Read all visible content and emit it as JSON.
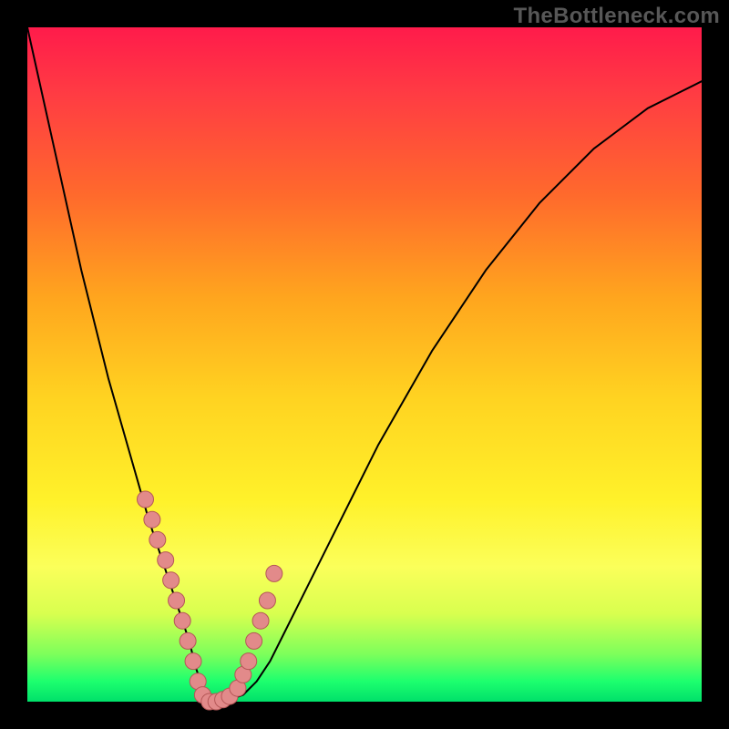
{
  "watermark": "TheBottleneck.com",
  "colors": {
    "frame_bg": "#000000",
    "watermark_text": "#575757",
    "gradient_top": "#ff1b4b",
    "gradient_bottom": "#00e06a",
    "curve_stroke": "#000000",
    "dot_fill": "#e28a8a",
    "dot_stroke": "#b55757"
  },
  "chart_data": {
    "type": "line",
    "title": "",
    "xlabel": "",
    "ylabel": "",
    "xlim": [
      0,
      100
    ],
    "ylim": [
      0,
      100
    ],
    "grid": false,
    "legend": false,
    "series": [
      {
        "name": "curve",
        "x": [
          0,
          2,
          4,
          6,
          8,
          10,
          12,
          14,
          16,
          18,
          20,
          22,
          24,
          25,
          26,
          27,
          28,
          30,
          32,
          34,
          36,
          38,
          40,
          44,
          48,
          52,
          56,
          60,
          64,
          68,
          72,
          76,
          80,
          84,
          88,
          92,
          96,
          100
        ],
        "y": [
          100,
          91,
          82,
          73,
          64,
          56,
          48,
          41,
          34,
          27,
          21,
          15,
          9,
          5,
          2,
          0.5,
          0,
          0.3,
          1,
          3,
          6,
          10,
          14,
          22,
          30,
          38,
          45,
          52,
          58,
          64,
          69,
          74,
          78,
          82,
          85,
          88,
          90,
          92
        ]
      }
    ],
    "dots": {
      "name": "highlight-points",
      "x": [
        17.5,
        18.5,
        19.3,
        20.5,
        21.3,
        22.1,
        23.0,
        23.8,
        24.6,
        25.3,
        26.0,
        27.0,
        28.0,
        29.0,
        30.0,
        31.2,
        32.0,
        32.8,
        33.6,
        34.6,
        35.6,
        36.6
      ],
      "y": [
        30,
        27,
        24,
        21,
        18,
        15,
        12,
        9,
        6,
        3,
        1,
        0,
        0,
        0.3,
        0.8,
        2,
        4,
        6,
        9,
        12,
        15,
        19
      ]
    },
    "dot_radius_px": 9
  }
}
